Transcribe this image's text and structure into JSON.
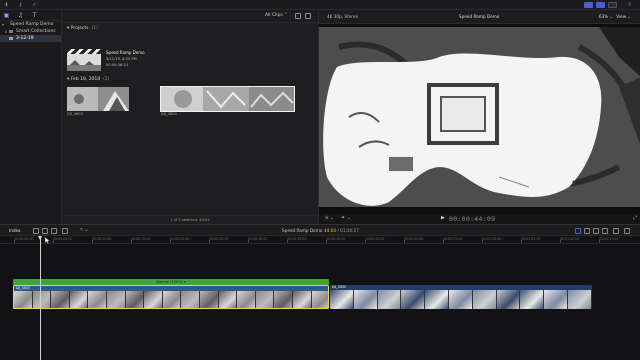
{
  "sidebar": {
    "library": "Speed Ramp Demo",
    "smart_collections": "Smart Collections",
    "event": "3-12-19"
  },
  "browser": {
    "filter": "All Clips",
    "projects_header": "Projects",
    "projects_count": "(1)",
    "project": {
      "name": "Speed Ramp Demo",
      "date": "3/12/19, 8:03 PM",
      "duration": "00:00:36:23"
    },
    "date_header": "Feb 18, 2018",
    "date_count": "(2)",
    "clips": [
      "DJI_0803",
      "DJI_0800"
    ],
    "footer": "1 of 3 selected, 44:04"
  },
  "viewer": {
    "format": "4K 30p, Stereo",
    "title": "Speed Ramp Demo",
    "zoom": "63%",
    "view_label": "View",
    "timecode": "00:00:44:09"
  },
  "timeline_bar": {
    "index_label": "Index",
    "project": "Speed Ramp Demo",
    "position": "44:04",
    "duration": "01:20:27"
  },
  "timeline": {
    "ruler": [
      "00:00:00:00",
      "00:00:05:00",
      "00:00:10:00",
      "00:00:15:00",
      "00:00:20:00",
      "00:00:25:00",
      "00:00:30:00",
      "00:00:35:00",
      "00:00:40:00",
      "00:00:45:00",
      "00:00:50:00",
      "00:00:55:00",
      "00:01:00:00",
      "00:01:05:00",
      "00:01:10:00",
      "00:01:15:00"
    ],
    "retime_label": "Normal (100%) ▾",
    "clip1_name": "DJI_0803",
    "clip2_name": "DJI_0800"
  },
  "colors": {
    "accent": "#4f5bd5",
    "retime": "#41a33a",
    "selection": "#f1d34a",
    "clip_blue": "#2a5b8a"
  }
}
